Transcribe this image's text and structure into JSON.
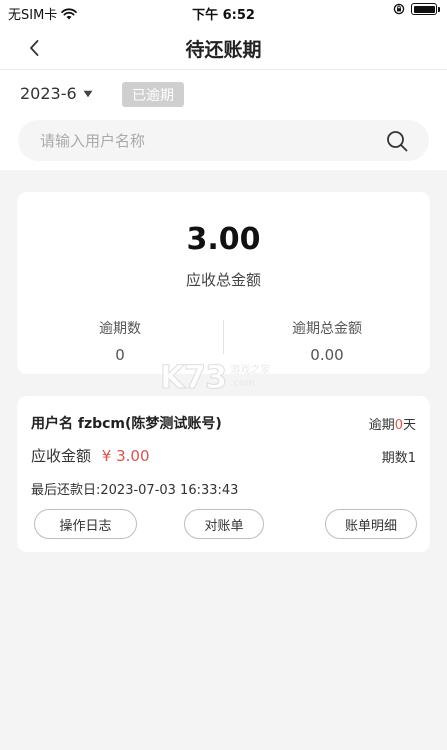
{
  "status_bar": {
    "carrier": "无SIM卡",
    "time": "下午 6:52"
  },
  "nav": {
    "title": "待还账期"
  },
  "filter": {
    "date": "2023-6",
    "overdue_tag": "已逾期"
  },
  "search": {
    "placeholder": "请输入用户名称"
  },
  "summary": {
    "total_amount": "3.00",
    "total_label": "应收总金额",
    "overdue_count_label": "逾期数",
    "overdue_count_value": "0",
    "overdue_total_label": "逾期总金额",
    "overdue_total_value": "0.00"
  },
  "watermark": {
    "logo": "K73",
    "line1": "游戏之家",
    "line2": ".com"
  },
  "bill": {
    "user_prefix": "用户名",
    "user_name": "fzbcm(陈梦测试账号)",
    "overdue_prefix": "逾期",
    "overdue_days": "0",
    "overdue_suffix": "天",
    "amount_label": "应收金额",
    "amount_value": "¥ 3.00",
    "periods": "期数1",
    "last_repay": "最后还款日:2023-07-03 16:33:43",
    "btn_log": "操作日志",
    "btn_reconcile": "对账单",
    "btn_detail": "账单明细"
  },
  "colors": {
    "accent_red": "#e05a4e",
    "tag_gray": "#cfcfcf"
  }
}
